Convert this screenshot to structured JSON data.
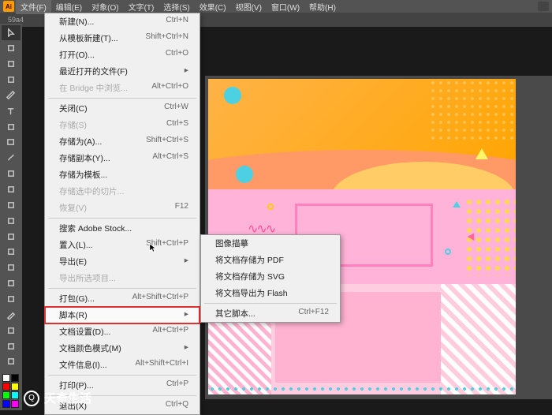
{
  "menubar": {
    "items": [
      "文件(F)",
      "编辑(E)",
      "对象(O)",
      "文字(T)",
      "选择(S)",
      "效果(C)",
      "视图(V)",
      "窗口(W)",
      "帮助(H)"
    ]
  },
  "filename": "59a4",
  "file_menu": [
    {
      "label": "新建(N)...",
      "shortcut": "Ctrl+N"
    },
    {
      "label": "从模板新建(T)...",
      "shortcut": "Shift+Ctrl+N"
    },
    {
      "label": "打开(O)...",
      "shortcut": "Ctrl+O"
    },
    {
      "label": "最近打开的文件(F)",
      "arrow": true
    },
    {
      "label": "在 Bridge 中浏览...",
      "shortcut": "Alt+Ctrl+O",
      "disabled": true
    },
    {
      "sep": true
    },
    {
      "label": "关闭(C)",
      "shortcut": "Ctrl+W"
    },
    {
      "label": "存储(S)",
      "shortcut": "Ctrl+S",
      "disabled": true
    },
    {
      "label": "存储为(A)...",
      "shortcut": "Shift+Ctrl+S"
    },
    {
      "label": "存储副本(Y)...",
      "shortcut": "Alt+Ctrl+S"
    },
    {
      "label": "存储为模板...",
      "shortcut": ""
    },
    {
      "label": "存储选中的切片...",
      "shortcut": "",
      "disabled": true
    },
    {
      "label": "恢复(V)",
      "shortcut": "F12",
      "disabled": true
    },
    {
      "sep": true
    },
    {
      "label": "搜索 Adobe Stock...",
      "shortcut": ""
    },
    {
      "label": "置入(L)...",
      "shortcut": "Shift+Ctrl+P"
    },
    {
      "label": "导出(E)",
      "arrow": true
    },
    {
      "label": "导出所选项目...",
      "shortcut": "",
      "disabled": true
    },
    {
      "sep": true
    },
    {
      "label": "打包(G)...",
      "shortcut": "Alt+Shift+Ctrl+P"
    },
    {
      "label": "脚本(R)",
      "arrow": true,
      "highlight": true
    },
    {
      "label": "文档设置(D)...",
      "shortcut": "Alt+Ctrl+P"
    },
    {
      "label": "文档颜色模式(M)",
      "arrow": true
    },
    {
      "label": "文件信息(I)...",
      "shortcut": "Alt+Shift+Ctrl+I"
    },
    {
      "sep": true
    },
    {
      "label": "打印(P)...",
      "shortcut": "Ctrl+P"
    },
    {
      "sep": true
    },
    {
      "label": "退出(X)",
      "shortcut": "Ctrl+Q"
    }
  ],
  "scripts_submenu": [
    {
      "label": "图像描摹"
    },
    {
      "label": "将文档存储为 PDF"
    },
    {
      "label": "将文档存储为 SVG"
    },
    {
      "label": "将文档导出为 Flash"
    },
    {
      "sep": true
    },
    {
      "label": "其它脚本...",
      "shortcut": "Ctrl+F12"
    }
  ],
  "watermark": "天奇生活",
  "tool_names": [
    "selection",
    "direct-select",
    "wand",
    "lasso",
    "pen",
    "type",
    "line",
    "rect",
    "brush",
    "pencil",
    "eraser",
    "rotate",
    "scale",
    "width",
    "warp",
    "shape-builder",
    "mesh",
    "gradient",
    "eyedropper",
    "blend",
    "symbol",
    "graph",
    "artboard",
    "slice",
    "hand",
    "zoom"
  ],
  "swatches": [
    "#ffffff",
    "#000000",
    "#ff0000",
    "#ffff00",
    "#00ff00",
    "#00ffff",
    "#0000ff",
    "#ff00ff"
  ]
}
